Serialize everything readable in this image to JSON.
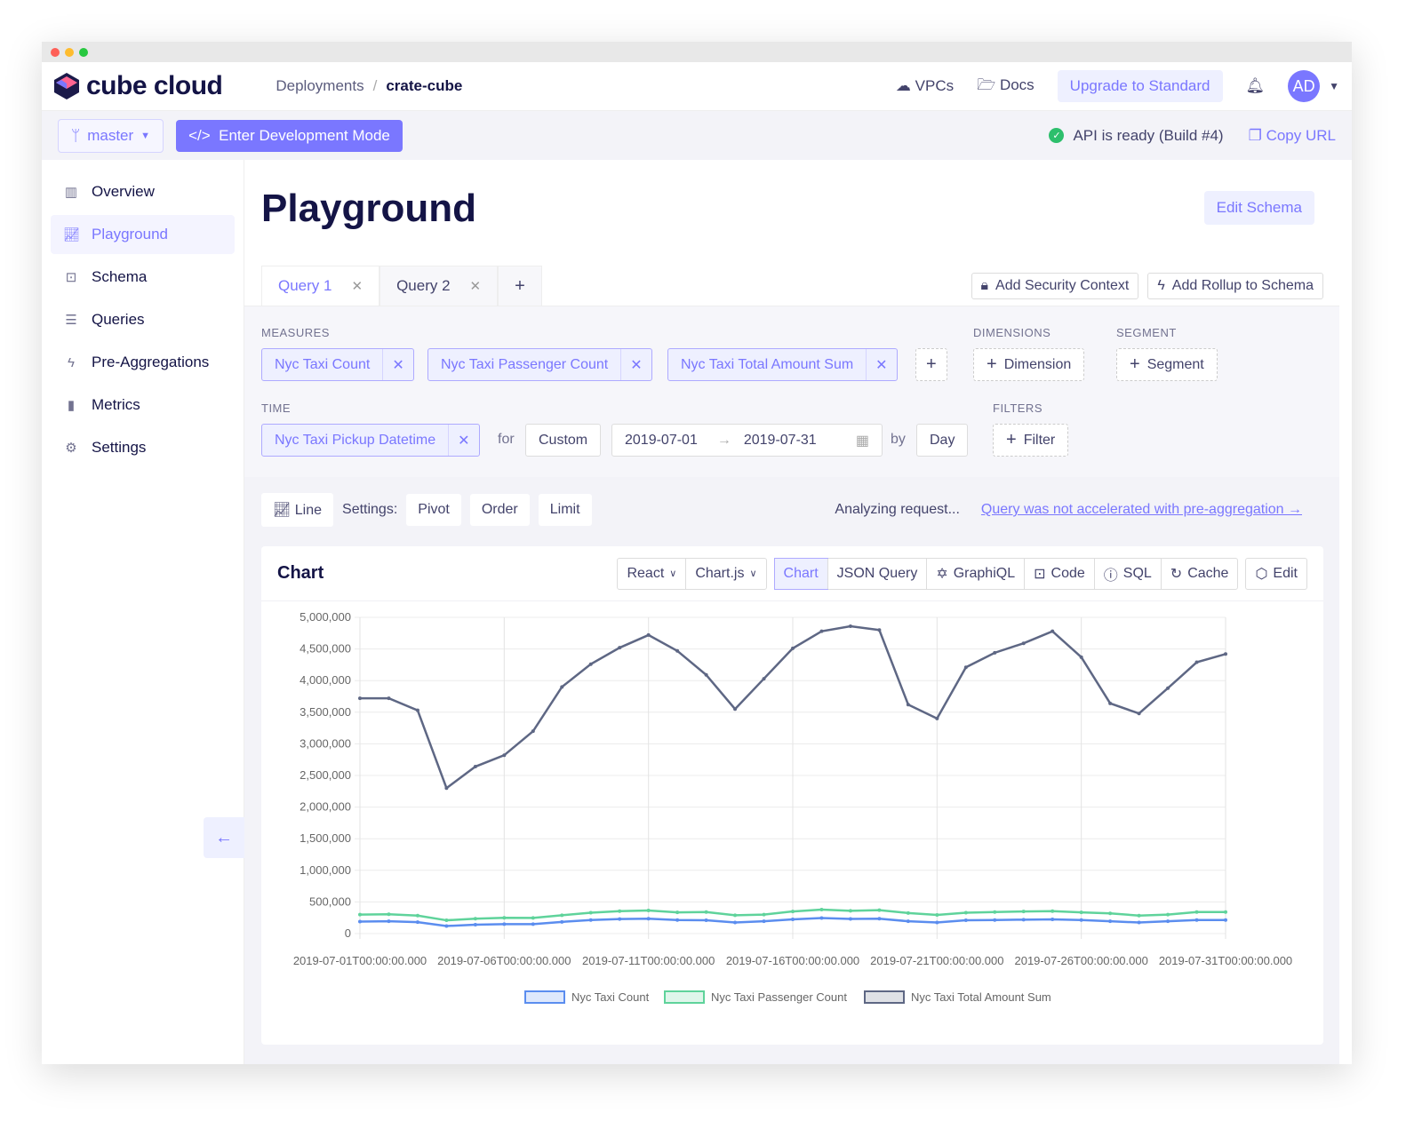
{
  "app": {
    "logo_text": "cube cloud",
    "breadcrumb": [
      "Deployments",
      "crate-cube"
    ],
    "nav": {
      "vpcs": "VPCs",
      "docs": "Docs",
      "upgrade": "Upgrade to Standard",
      "avatar": "AD"
    },
    "accent": "#7a77ff"
  },
  "subheader": {
    "branch": "master",
    "dev_mode": "Enter Development Mode",
    "status": "API is ready (Build #4)",
    "copy_url": "Copy URL"
  },
  "sidebar": {
    "items": [
      {
        "label": "Overview",
        "icon": "layout-icon"
      },
      {
        "label": "Playground",
        "icon": "line-chart-icon"
      },
      {
        "label": "Schema",
        "icon": "terminal-icon"
      },
      {
        "label": "Queries",
        "icon": "list-icon"
      },
      {
        "label": "Pre-Aggregations",
        "icon": "bolt-icon"
      },
      {
        "label": "Metrics",
        "icon": "bar-chart-icon"
      },
      {
        "label": "Settings",
        "icon": "gear-icon"
      }
    ],
    "active": "Playground"
  },
  "page": {
    "title": "Playground",
    "edit_schema": "Edit Schema"
  },
  "tabs": [
    {
      "label": "Query 1"
    },
    {
      "label": "Query 2"
    }
  ],
  "tab_actions": {
    "security": "Add Security Context",
    "rollup": "Add Rollup to Schema"
  },
  "query": {
    "measures_label": "MEASURES",
    "measures": [
      "Nyc Taxi Count",
      "Nyc Taxi Passenger Count",
      "Nyc Taxi Total Amount Sum"
    ],
    "dimensions_label": "DIMENSIONS",
    "dimension_btn": "Dimension",
    "segment_label": "SEGMENT",
    "segment_btn": "Segment",
    "time_label": "TIME",
    "time_dim": "Nyc Taxi Pickup Datetime",
    "for": "for",
    "range": "Custom",
    "date_from": "2019-07-01",
    "date_to": "2019-07-31",
    "by": "by",
    "granularity": "Day",
    "filters_label": "FILTERS",
    "filter_btn": "Filter"
  },
  "settings": {
    "chart_type": "Line",
    "label": "Settings:",
    "pivot": "Pivot",
    "order": "Order",
    "limit": "Limit",
    "analyzing": "Analyzing request...",
    "pre_agg_link": "Query was not accelerated with pre-aggregation →"
  },
  "card": {
    "title": "Chart",
    "framework": "React",
    "library": "Chart.js",
    "views": [
      "Chart",
      "JSON Query",
      "GraphiQL",
      "Code",
      "SQL",
      "Cache"
    ],
    "active_view": "Chart",
    "edit": "Edit"
  },
  "chart_data": {
    "type": "line",
    "ylim": [
      0,
      5000000
    ],
    "grid": true,
    "legend": "bottom",
    "yticks": [
      "5,000,000",
      "4,500,000",
      "4,000,000",
      "3,500,000",
      "3,000,000",
      "2,500,000",
      "2,000,000",
      "1,500,000",
      "1,000,000",
      "500,000",
      "0"
    ],
    "xticks": [
      "2019-07-01T00:00:00.000",
      "2019-07-06T00:00:00.000",
      "2019-07-11T00:00:00.000",
      "2019-07-16T00:00:00.000",
      "2019-07-21T00:00:00.000",
      "2019-07-26T00:00:00.000",
      "2019-07-31T00:00:00.000"
    ],
    "x_start": "2019-07-01",
    "x_end": "2019-07-31",
    "series": [
      {
        "name": "Nyc Taxi Count",
        "color": "#5b8def",
        "values": [
          190000,
          195000,
          180000,
          120000,
          140000,
          150000,
          150000,
          185000,
          215000,
          230000,
          235000,
          215000,
          210000,
          175000,
          195000,
          225000,
          245000,
          232000,
          235000,
          195000,
          175000,
          210000,
          215000,
          220000,
          225000,
          215000,
          195000,
          175000,
          195000,
          215000,
          215000
        ]
      },
      {
        "name": "Nyc Taxi Passenger Count",
        "color": "#5fd39b",
        "values": [
          300000,
          305000,
          285000,
          210000,
          235000,
          250000,
          248000,
          290000,
          330000,
          355000,
          365000,
          335000,
          340000,
          290000,
          300000,
          350000,
          380000,
          360000,
          370000,
          325000,
          295000,
          330000,
          340000,
          350000,
          355000,
          335000,
          320000,
          285000,
          300000,
          340000,
          340000
        ]
      },
      {
        "name": "Nyc Taxi Total Amount Sum",
        "color": "#5e6784",
        "values": [
          3720000,
          3720000,
          3530000,
          2300000,
          2640000,
          2820000,
          3200000,
          3900000,
          4260000,
          4520000,
          4720000,
          4470000,
          4090000,
          3550000,
          4030000,
          4510000,
          4780000,
          4860000,
          4800000,
          3620000,
          3400000,
          4210000,
          4440000,
          4590000,
          4780000,
          4370000,
          3640000,
          3480000,
          3880000,
          4290000,
          4420000
        ]
      }
    ]
  }
}
